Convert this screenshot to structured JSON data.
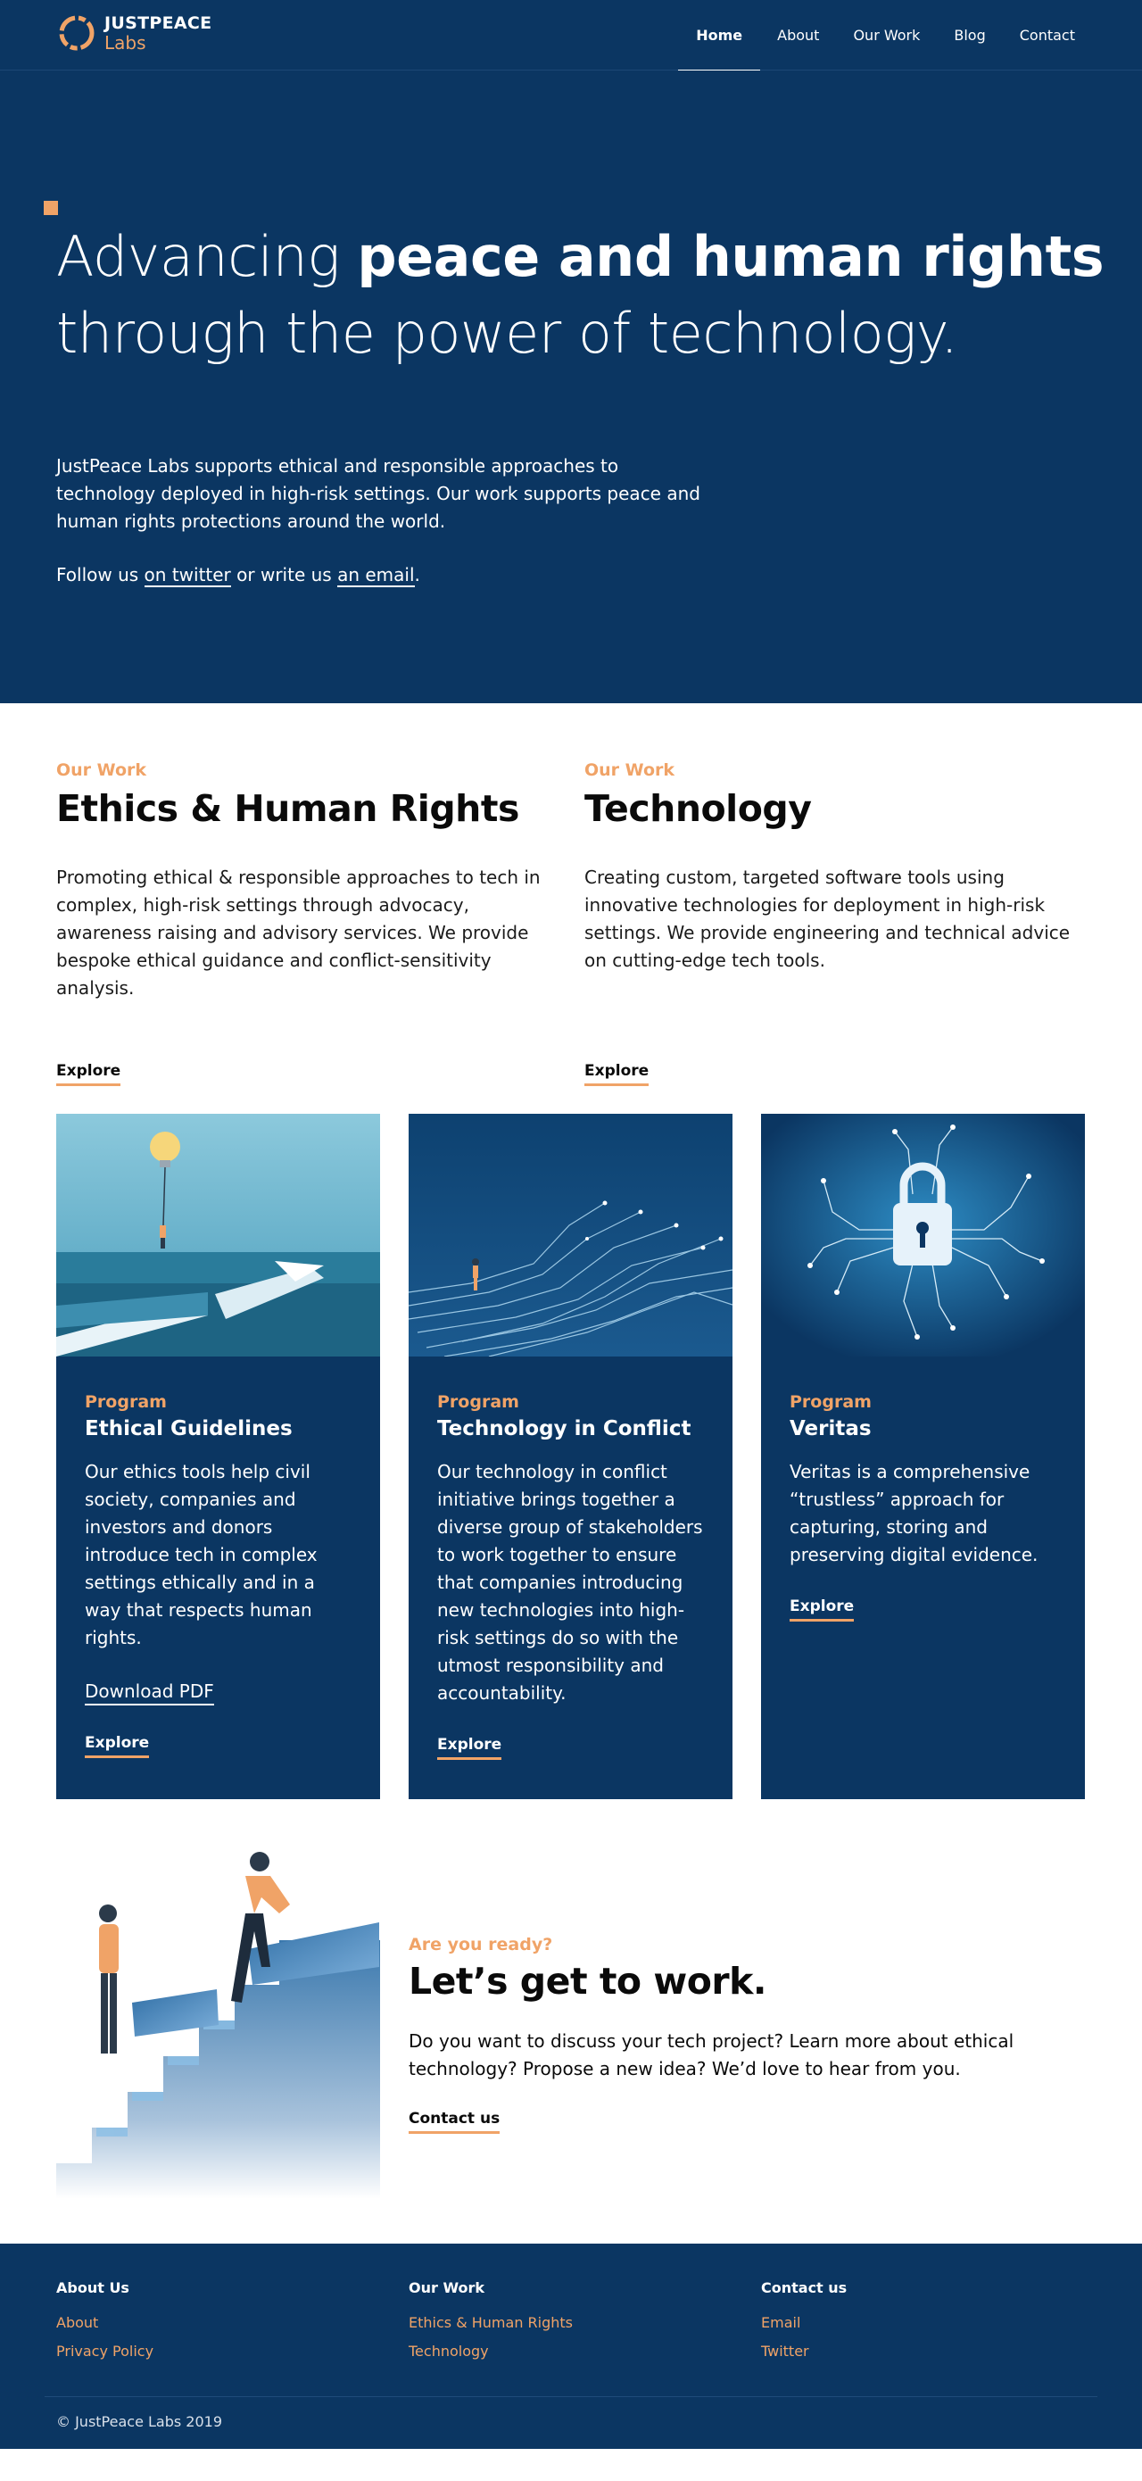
{
  "brand": {
    "name_line1": "JUSTPEACE",
    "name_line2": "Labs",
    "accent": "#f0a367",
    "navy": "#0b3662"
  },
  "nav": {
    "items": [
      {
        "label": "Home",
        "active": true
      },
      {
        "label": "About"
      },
      {
        "label": "Our Work"
      },
      {
        "label": "Blog"
      },
      {
        "label": "Contact"
      }
    ]
  },
  "hero": {
    "title_light": "Advancing ",
    "title_bold": "peace and human rights",
    "title_rest": "through the power of technology.",
    "intro": "JustPeace Labs supports ethical and responsible approaches to technology deployed in high-risk settings. Our work supports peace and human rights protections around the world.",
    "follow_prefix": "Follow us ",
    "twitter_link": "on twitter",
    "follow_middle": " or write us ",
    "email_link": "an email",
    "follow_suffix": "."
  },
  "work": {
    "ethics": {
      "eyebrow": "Our Work",
      "title": "Ethics & Human Rights",
      "text": "Promoting ethical & responsible approaches to tech in complex, high-risk settings through advocacy, awareness raising and advisory services. We provide bespoke ethical guidance and conflict-sensitivity analysis.",
      "link": "Explore"
    },
    "tech": {
      "eyebrow": "Our Work",
      "title": "Technology",
      "text": "Creating custom, targeted software tools using innovative technologies for deployment in high-risk settings. We provide engineering and technical advice on cutting-edge tech tools.",
      "link": "Explore"
    }
  },
  "programs": [
    {
      "eyebrow": "Program",
      "title": "Ethical Guidelines",
      "text": "Our ethics tools help civil society, companies and investors and donors introduce tech in complex settings ethically and in a way that respects human rights.",
      "pdf_link": "Download PDF",
      "link": "Explore"
    },
    {
      "eyebrow": "Program",
      "title": "Technology in Conflict",
      "text": "Our technology in conflict initiative brings together a diverse group of stakeholders to work together to ensure that companies introducing new technologies into high-risk settings do so with the utmost responsibility and accountability.",
      "link": "Explore"
    },
    {
      "eyebrow": "Program",
      "title": "Veritas",
      "text": "Veritas is a comprehensive “trustless” approach for capturing, storing and preserving digital evidence.",
      "link": "Explore"
    }
  ],
  "cta": {
    "eyebrow": "Are you ready?",
    "title": "Let’s get to work.",
    "text": "Do you want to discuss your tech project? Learn more about ethical technology? Propose a new idea? We’d love to hear from you.",
    "link": "Contact us"
  },
  "footer": {
    "about": {
      "heading": "About Us",
      "links": [
        "About",
        "Privacy Policy"
      ]
    },
    "work": {
      "heading": "Our Work",
      "links": [
        "Ethics & Human Rights",
        "Technology"
      ]
    },
    "contact": {
      "heading": "Contact us",
      "links": [
        "Email",
        "Twitter"
      ]
    },
    "copyright": "© JustPeace Labs 2019"
  }
}
